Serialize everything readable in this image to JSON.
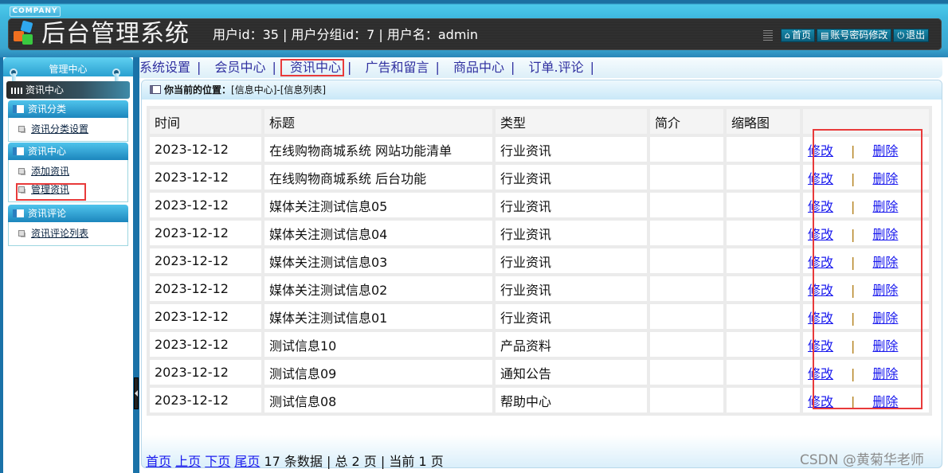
{
  "header": {
    "company": "COMPANY",
    "title": "后台管理系统",
    "user_info": "用户id：35 | 用户分组id：7 | 用户名：admin",
    "buttons": [
      {
        "icon": "home-icon",
        "glyph": "⌂",
        "label": "首页"
      },
      {
        "icon": "list-icon",
        "glyph": "▤",
        "label": "账号密码修改"
      },
      {
        "icon": "power-icon",
        "glyph": "⏻",
        "label": "退出"
      }
    ]
  },
  "sidebar": {
    "title": "管理中心",
    "current": "资讯中心",
    "groups": [
      {
        "title": "资讯分类",
        "items": [
          {
            "label": "资讯分类设置"
          }
        ]
      },
      {
        "title": "资讯中心",
        "items": [
          {
            "label": "添加资讯"
          },
          {
            "label": "管理资讯"
          }
        ]
      },
      {
        "title": "资讯评论",
        "items": [
          {
            "label": "资讯评论列表"
          }
        ]
      }
    ]
  },
  "topnav": {
    "items": [
      "系统设置",
      "会员中心",
      "资讯中心",
      "广告和留言",
      "商品中心",
      "订单.评论"
    ],
    "separator": "|",
    "active": "资讯中心"
  },
  "breadcrumb": {
    "label": "你当前的位置：",
    "path": "[信息中心]-[信息列表]"
  },
  "table": {
    "columns": [
      "时间",
      "标题",
      "类型",
      "简介",
      "缩略图",
      ""
    ],
    "rows": [
      {
        "time": "2023-12-12",
        "title": "在线购物商城系统 网站功能清单",
        "type": "行业资讯",
        "intro": "",
        "thumb": ""
      },
      {
        "time": "2023-12-12",
        "title": "在线购物商城系统 后台功能",
        "type": "行业资讯",
        "intro": "",
        "thumb": ""
      },
      {
        "time": "2023-12-12",
        "title": "媒体关注测试信息05",
        "type": "行业资讯",
        "intro": "",
        "thumb": ""
      },
      {
        "time": "2023-12-12",
        "title": "媒体关注测试信息04",
        "type": "行业资讯",
        "intro": "",
        "thumb": ""
      },
      {
        "time": "2023-12-12",
        "title": "媒体关注测试信息03",
        "type": "行业资讯",
        "intro": "",
        "thumb": ""
      },
      {
        "time": "2023-12-12",
        "title": "媒体关注测试信息02",
        "type": "行业资讯",
        "intro": "",
        "thumb": ""
      },
      {
        "time": "2023-12-12",
        "title": "媒体关注测试信息01",
        "type": "行业资讯",
        "intro": "",
        "thumb": ""
      },
      {
        "time": "2023-12-12",
        "title": "测试信息10",
        "type": "产品资料",
        "intro": "",
        "thumb": ""
      },
      {
        "time": "2023-12-12",
        "title": "测试信息09",
        "type": "通知公告",
        "intro": "",
        "thumb": ""
      },
      {
        "time": "2023-12-12",
        "title": "测试信息08",
        "type": "帮助中心",
        "intro": "",
        "thumb": ""
      }
    ],
    "edit_label": "修改",
    "delete_label": "删除",
    "action_separator": "|"
  },
  "pager": {
    "first": "首页",
    "prev": "上页",
    "next": "下页",
    "last": "尾页",
    "summary": "17 条数据 | 总 2 页 | 当前 1 页"
  },
  "watermark": "CSDN @黄菊华老师",
  "colors": {
    "highlight_box": "#e83a3a",
    "link": "#1a1aee",
    "nav_link": "#3030a0"
  }
}
